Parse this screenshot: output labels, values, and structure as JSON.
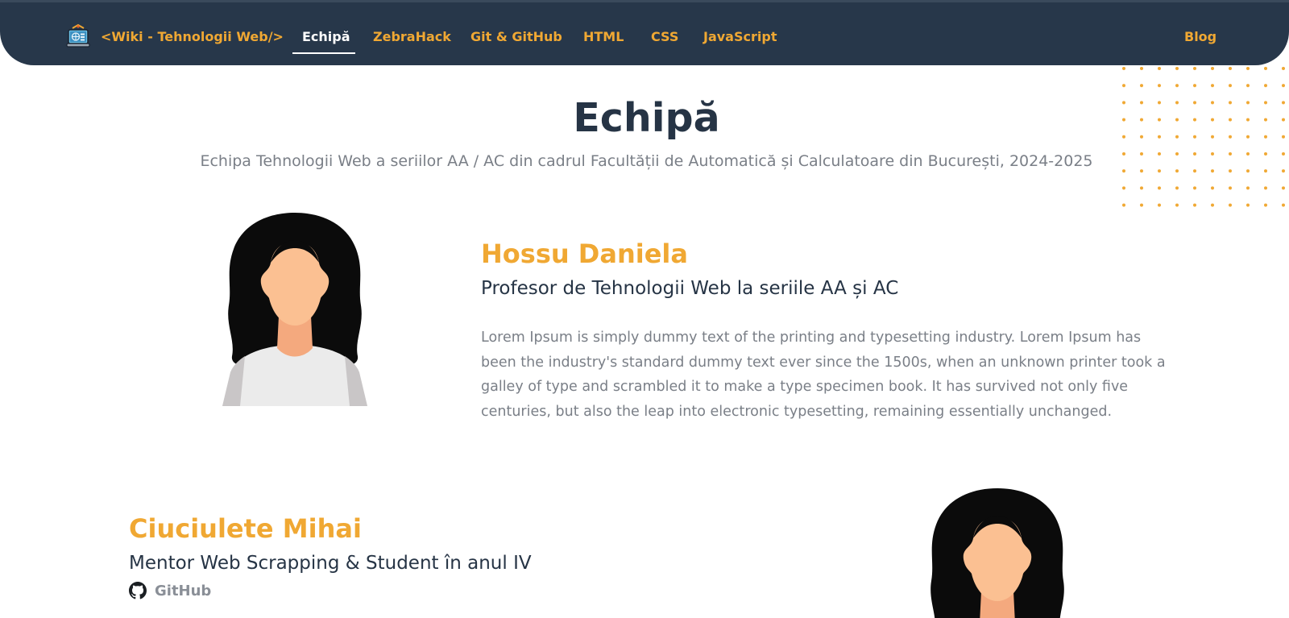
{
  "navbar": {
    "brand": "<Wiki - Tehnologii Web/>",
    "links": [
      "Echipă",
      "ZebraHack",
      "Git & GitHub",
      "HTML",
      "CSS",
      "JavaScript"
    ],
    "active_index": 0,
    "blog": "Blog"
  },
  "header": {
    "title": "Echipă",
    "subtitle": "Echipa Tehnologii Web a seriilor AA / AC din cadrul Facultății de Automatică și Calculatoare din București, 2024-2025"
  },
  "members": [
    {
      "name": "Hossu Daniela",
      "role": "Profesor de Tehnologii Web la seriile AA și AC",
      "bio": "Lorem Ipsum is simply dummy text of the printing and typesetting industry. Lorem Ipsum has been the industry's standard dummy text ever since the 1500s, when an unknown printer took a galley of type and scrambled it to make a type specimen book. It has survived not only five centuries, but also the leap into electronic typesetting, remaining essentially unchanged."
    },
    {
      "name": "Ciuciulete Mihai",
      "role": "Mentor Web Scrapping & Student în anul IV",
      "link": "GitHub"
    }
  ],
  "colors": {
    "navbar_bg": "#27374a",
    "accent": "#f0a833",
    "heading": "#263445",
    "muted": "#7a7f87"
  },
  "icons": [
    "laptop-logo-icon",
    "github-icon"
  ]
}
